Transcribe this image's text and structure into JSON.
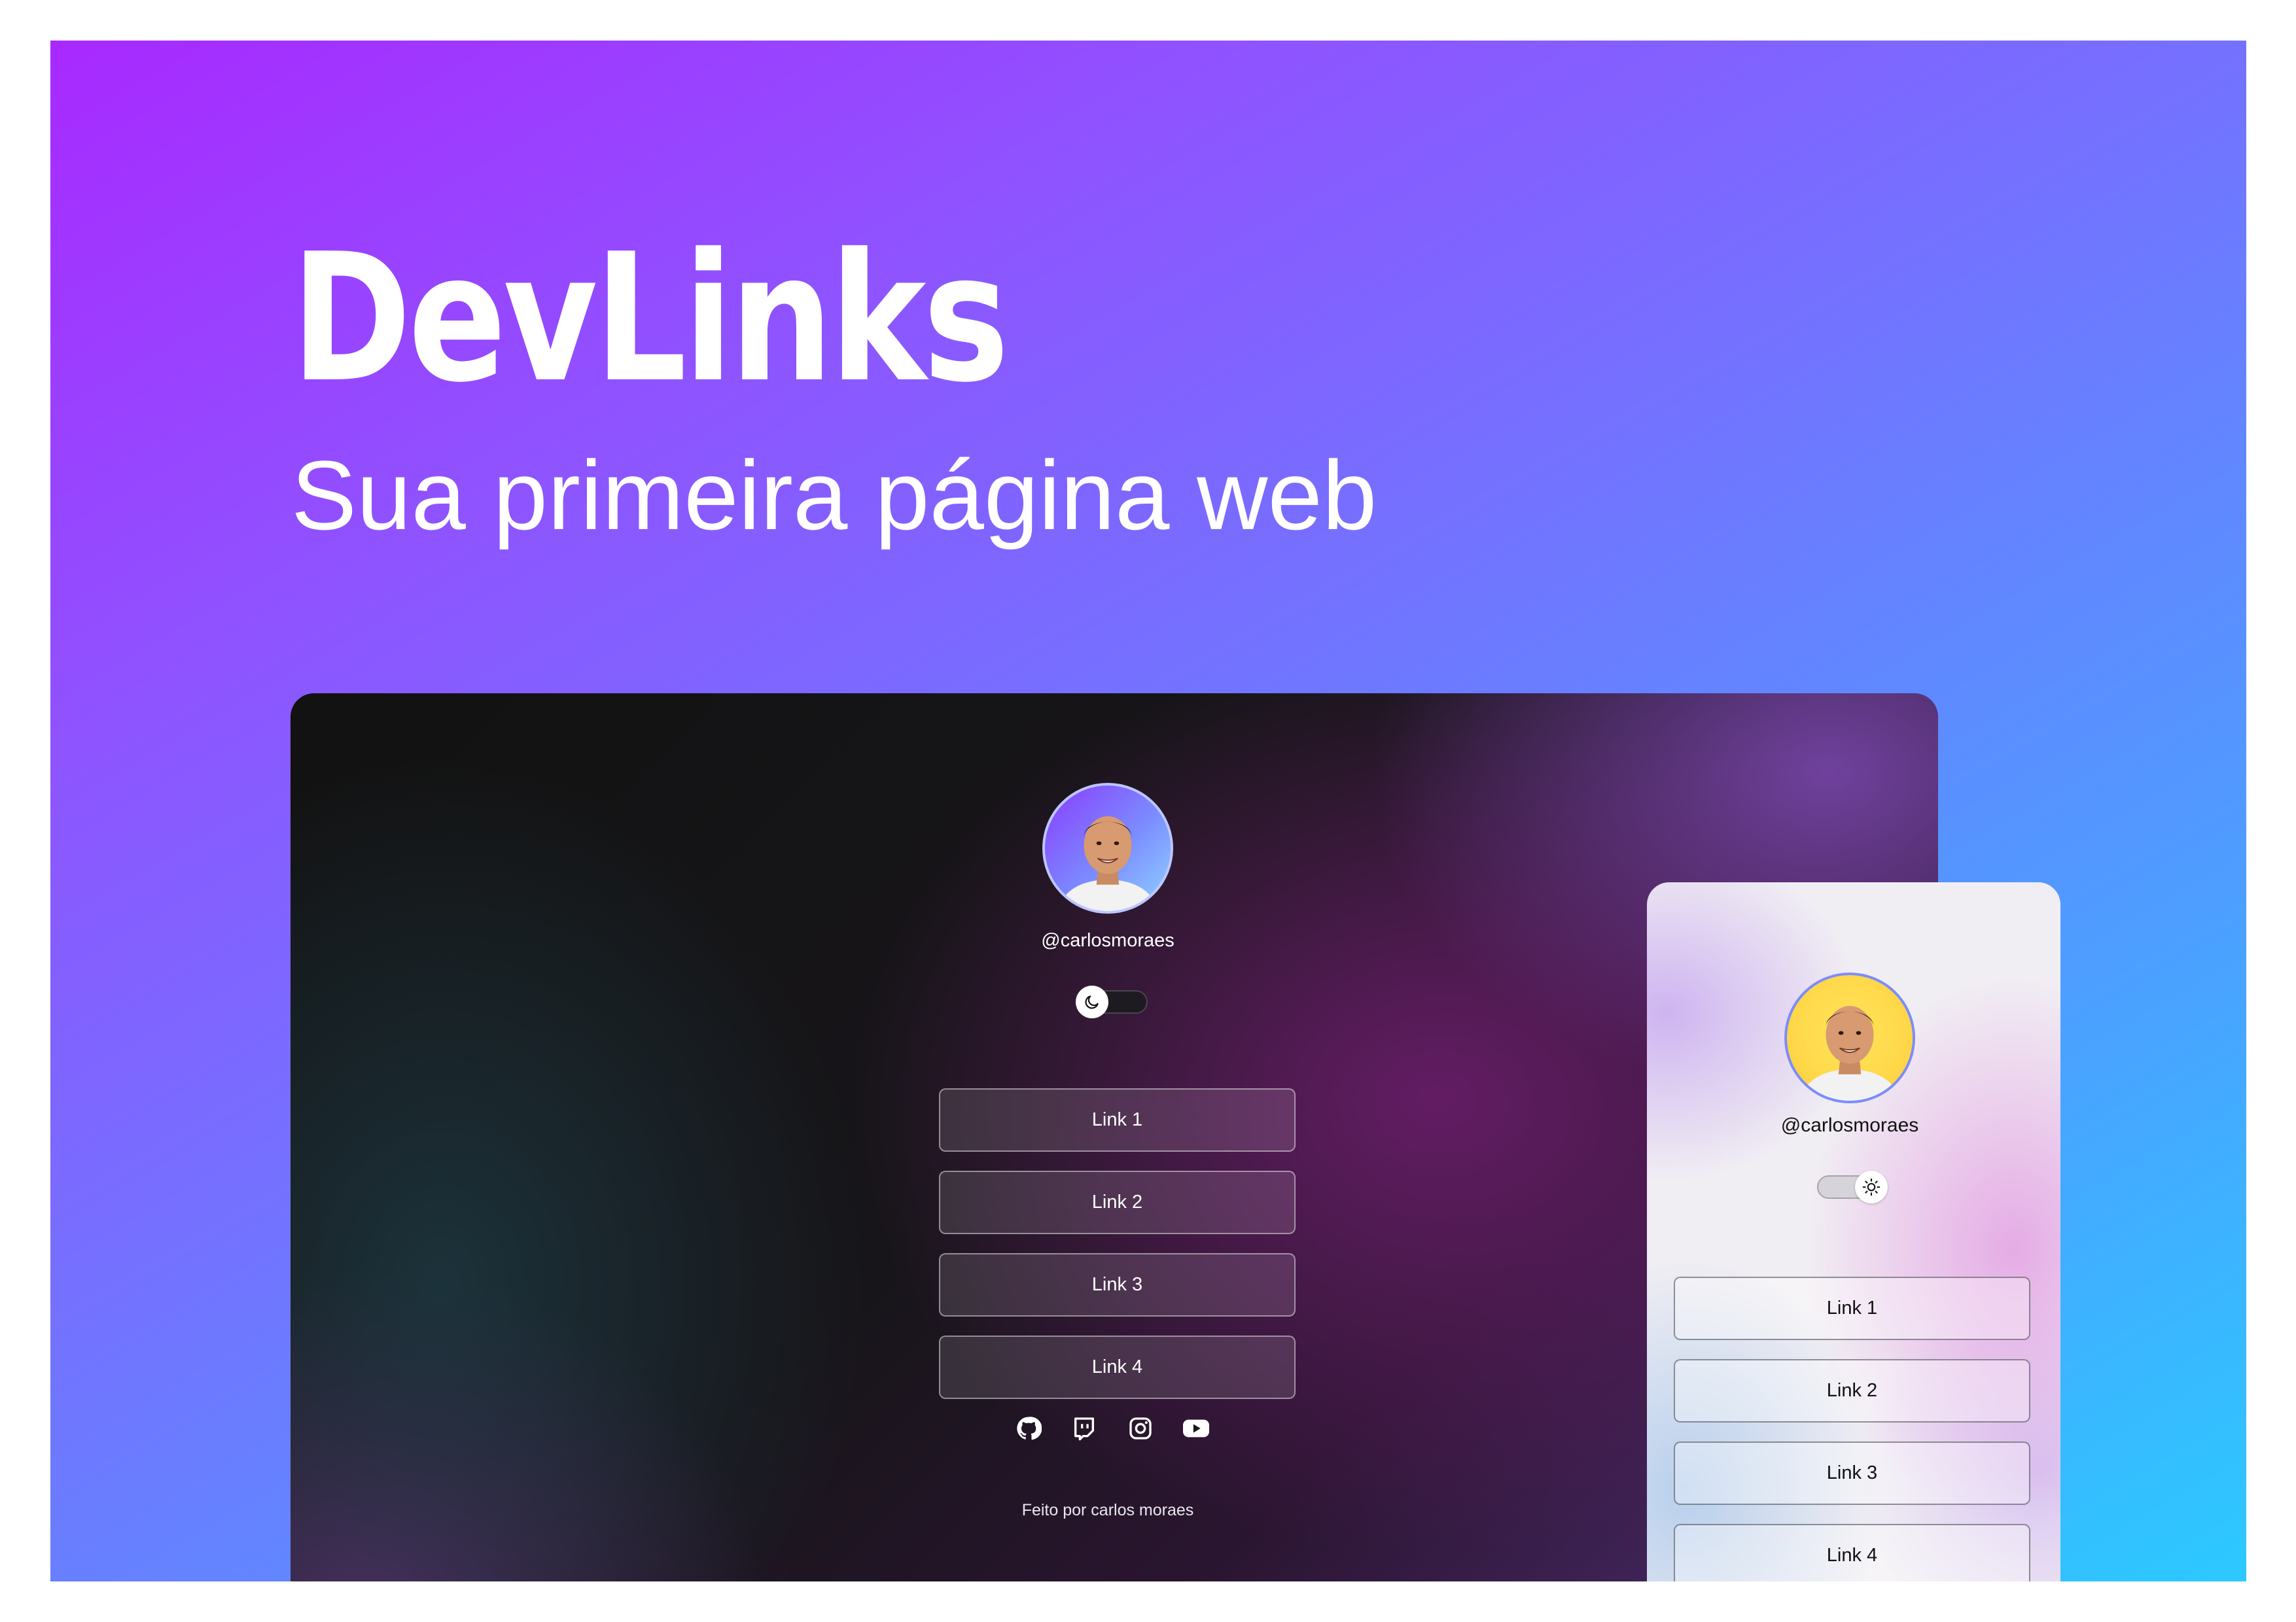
{
  "hero": {
    "title": "DevLinks",
    "subtitle": "Sua primeira página web"
  },
  "colors": {
    "gradient_start": "#a829ff",
    "gradient_end": "#2cc9ff",
    "dark_bg": "#121212",
    "light_bg": "#f1eef3",
    "avatar_dark_bg": "#8a3cff",
    "avatar_light_bg": "#ffd84a"
  },
  "dark_mockup": {
    "theme": "dark",
    "avatar_icon": "profile-photo",
    "username": "@carlosmoraes",
    "toggle_icon": "moon-icon",
    "links": [
      "Link 1",
      "Link 2",
      "Link 3",
      "Link 4"
    ],
    "social_icons": [
      "github-icon",
      "twitch-icon",
      "instagram-icon",
      "youtube-icon"
    ],
    "footer": "Feito por carlos moraes"
  },
  "light_mockup": {
    "theme": "light",
    "avatar_icon": "profile-photo",
    "username": "@carlosmoraes",
    "toggle_icon": "sun-icon",
    "links": [
      "Link 1",
      "Link 2",
      "Link 3",
      "Link 4"
    ]
  }
}
